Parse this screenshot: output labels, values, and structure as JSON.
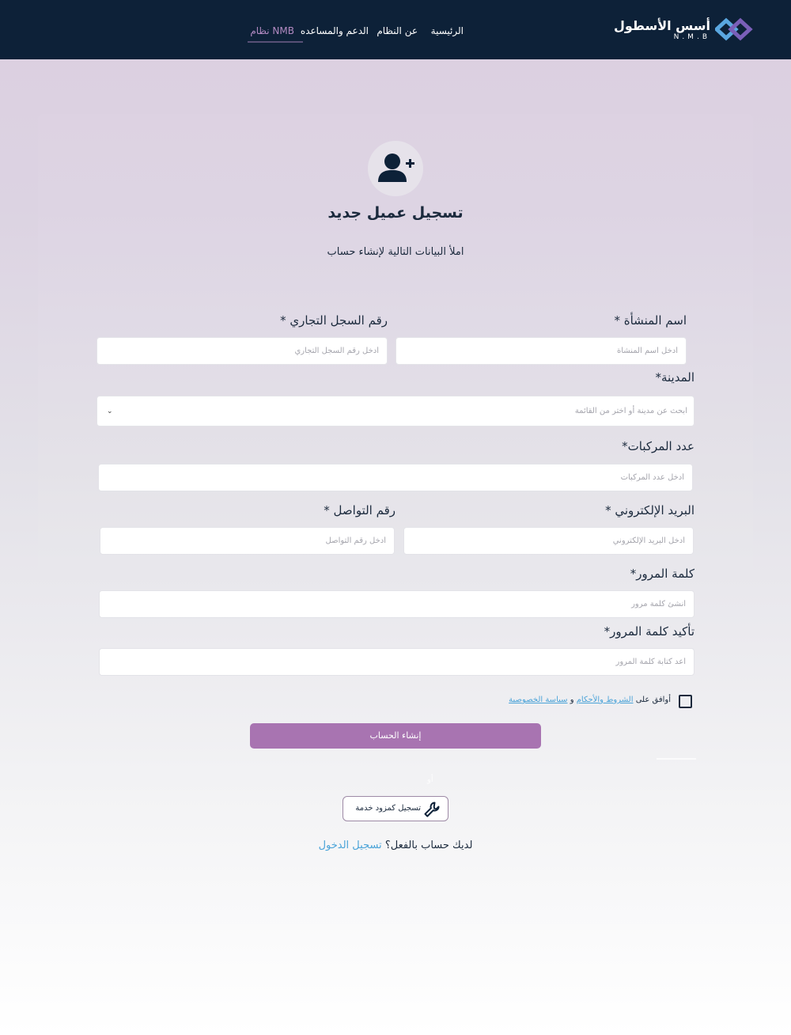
{
  "header": {
    "logo_text": "أسس الأسطول",
    "logo_sub": "N.M.B",
    "nav": {
      "home": "الرئيسية",
      "about": "عن النظام",
      "support": "الدعم والمساعده",
      "nmb": "نظام NMB"
    }
  },
  "form": {
    "title": "تسجيل عميل جديد",
    "subtitle": "املأ البيانات التالية لإنشاء حساب",
    "facility_name": {
      "label": "اسم المنشأة *",
      "placeholder": "أدخل اسم المنشأة"
    },
    "commercial_reg": {
      "label": "رقم السجل التجاري *",
      "placeholder": "أدخل رقم السجل التجاري"
    },
    "city": {
      "label": "المدينة*",
      "placeholder": "ابحث عن مدينة أو اختر من القائمة"
    },
    "vehicles": {
      "label": "عدد المركبات*",
      "placeholder": "أدخل عدد المركبات"
    },
    "email": {
      "label": "البريد الإلكتروني *",
      "placeholder": "أدخل البريد الإلكتروني"
    },
    "phone": {
      "label": "رقم التواصل *",
      "placeholder": "أدخل رقم التواصل"
    },
    "password": {
      "label": "كلمة المرور*",
      "placeholder": "أنشئ كلمة مرور"
    },
    "confirm_password": {
      "label": "تأكيد كلمة المرور*",
      "placeholder": "أعد كتابة كلمة المرور"
    },
    "agree": {
      "prefix": "أوافق على",
      "terms": "الشروط والأحكام",
      "and": "و",
      "privacy": "سياسة الخصوصية"
    },
    "submit": "إنشاء الحساب",
    "or": "أو",
    "provider_button": "تسجيل كمزود خدمة",
    "have_account": "لديك حساب بالفعل؟",
    "login_link": "تسجيل الدخول"
  },
  "colors": {
    "header_bg": "#0d2138",
    "accent": "#a874b1",
    "link": "#4aa3d8"
  },
  "icons": {
    "avatar": "user-plus-icon",
    "wrench": "wrench-icon",
    "chevron": "chevron-down-icon"
  }
}
